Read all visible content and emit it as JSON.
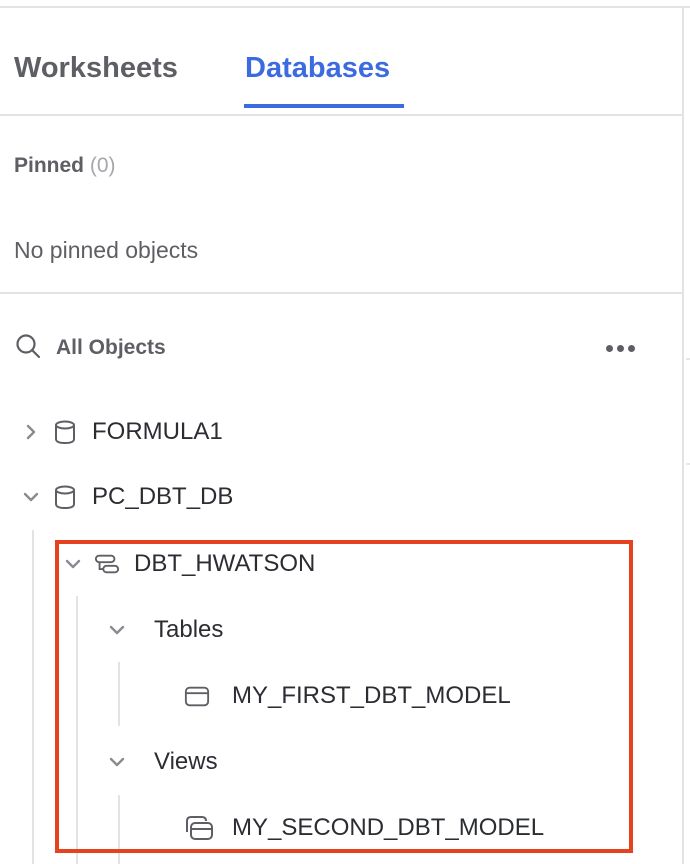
{
  "tabs": [
    {
      "label": "Worksheets",
      "active": false
    },
    {
      "label": "Databases",
      "active": true
    }
  ],
  "colors": {
    "accent": "#3c6ae0",
    "highlight": "#e5431f",
    "text_muted": "#5e5f65",
    "text_main": "#2b2d33"
  },
  "pinned": {
    "title": "Pinned",
    "count": "(0)",
    "empty_message": "No pinned objects"
  },
  "all_objects": {
    "label": "All Objects",
    "search_icon": "search-icon",
    "more_icon": "more-horizontal-icon"
  },
  "tree": {
    "databases": [
      {
        "name": "FORMULA1",
        "expanded": false,
        "icon": "database-icon"
      },
      {
        "name": "PC_DBT_DB",
        "expanded": true,
        "icon": "database-icon",
        "schemas": [
          {
            "name": "DBT_HWATSON",
            "expanded": true,
            "icon": "schema-icon",
            "groups": [
              {
                "name": "Tables",
                "expanded": true,
                "items": [
                  {
                    "name": "MY_FIRST_DBT_MODEL",
                    "icon": "table-icon"
                  }
                ]
              },
              {
                "name": "Views",
                "expanded": true,
                "items": [
                  {
                    "name": "MY_SECOND_DBT_MODEL",
                    "icon": "view-icon"
                  }
                ]
              }
            ]
          }
        ]
      }
    ]
  }
}
